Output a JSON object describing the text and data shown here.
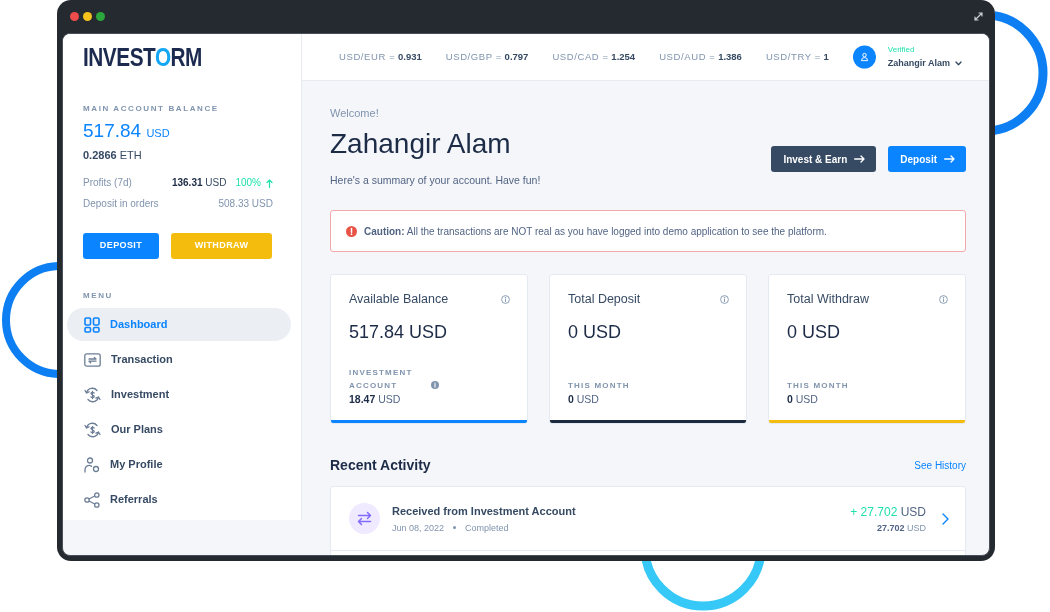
{
  "sidebar": {
    "logo": [
      {
        "text": "INVEST",
        "accent": false
      },
      {
        "text": "O",
        "accent": true
      },
      {
        "text": "RM",
        "accent": false
      }
    ],
    "balance": {
      "label": "MAIN ACCOUNT BALANCE",
      "amount": "517.84",
      "currency": "USD",
      "secondary_amount": "0.2866",
      "secondary_currency": "ETH"
    },
    "stats": [
      {
        "label": "Profits (7d)",
        "amount": "136.31",
        "currency": "USD",
        "kind": "highlight",
        "change": "100%"
      },
      {
        "label": "Deposit in orders",
        "amount": "508.33",
        "currency": "USD",
        "kind": "muted"
      }
    ],
    "buttons": [
      {
        "label": "DEPOSIT",
        "kind": "primary"
      },
      {
        "label": "WITHDRAW",
        "kind": "warning"
      }
    ],
    "menu_title": "MENU",
    "menu": [
      {
        "label": "Dashboard",
        "selected": true
      },
      {
        "label": "Transaction",
        "selected": false
      },
      {
        "label": "Investment",
        "selected": false
      },
      {
        "label": "Our Plans",
        "selected": false
      },
      {
        "label": "My Profile",
        "selected": false
      },
      {
        "label": "Referrals",
        "selected": false
      }
    ]
  },
  "top_bar": {
    "rates": [
      {
        "label": "USD/EUR =",
        "value": "0.931"
      },
      {
        "label": "USD/GBP =",
        "value": "0.797"
      },
      {
        "label": "USD/CAD =",
        "value": "1.254"
      },
      {
        "label": "USD/AUD =",
        "value": "1.386"
      },
      {
        "label": "USD/TRY =",
        "value": "1"
      }
    ],
    "user": {
      "status": "Verified",
      "name": "Zahangir Alam"
    }
  },
  "header": {
    "greeting": "Welcome!",
    "title": "Zahangir Alam",
    "subtitle": "Here's a summary of your account. Have fun!",
    "buttons": [
      {
        "label": "Invest & Earn",
        "kind": "dark"
      },
      {
        "label": "Deposit",
        "kind": "primary"
      }
    ]
  },
  "alert": {
    "text": "**Caution:** All the transactions are NOT real as you have logged into demo application to see the platform."
  },
  "cards": [
    {
      "title": "Available Balance",
      "amount": "517.84 USD",
      "sub_label": "INVESTMENT ACCOUNT",
      "sub_info": true,
      "sub_amount": "18.47",
      "sub_currency": "USD",
      "color": "#0a84ff"
    },
    {
      "title": "Total Deposit",
      "amount": "0 USD",
      "sub_label": "THIS MONTH",
      "sub_info": false,
      "sub_amount": "0",
      "sub_currency": "USD",
      "color": "#1c2b3d"
    },
    {
      "title": "Total Withdraw",
      "amount": "0 USD",
      "sub_label": "THIS MONTH",
      "sub_info": false,
      "sub_amount": "0",
      "sub_currency": "USD",
      "color": "#f4bd0e"
    }
  ],
  "activity": {
    "title": "Recent Activity",
    "link": "See History",
    "items": [
      {
        "title": "Received from Investment Account",
        "date": "Jun 08, 2022",
        "status": "Completed",
        "amount": "+ 27.702",
        "currency": "USD",
        "sub_amount": "27.702",
        "sub_currency": "USD"
      }
    ]
  }
}
